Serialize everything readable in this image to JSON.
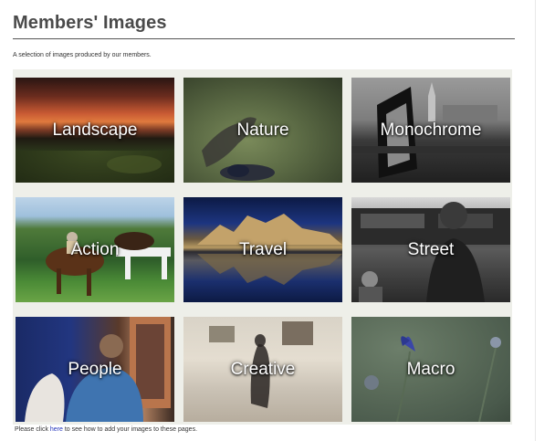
{
  "page": {
    "title": "Members' Images",
    "intro": "A selection of images produced by our members.",
    "footer_before": "Please click ",
    "footer_link": "here",
    "footer_after": " to see how to add your images to these pages."
  },
  "tiles": [
    {
      "label": "Landscape"
    },
    {
      "label": "Nature"
    },
    {
      "label": "Monochrome"
    },
    {
      "label": "Action"
    },
    {
      "label": "Travel"
    },
    {
      "label": "Street"
    },
    {
      "label": "People"
    },
    {
      "label": "Creative"
    },
    {
      "label": "Macro"
    }
  ],
  "colors": {
    "link": "#2233bb",
    "title": "#4a4a4a",
    "gallery_bg": "#eeefe9"
  }
}
